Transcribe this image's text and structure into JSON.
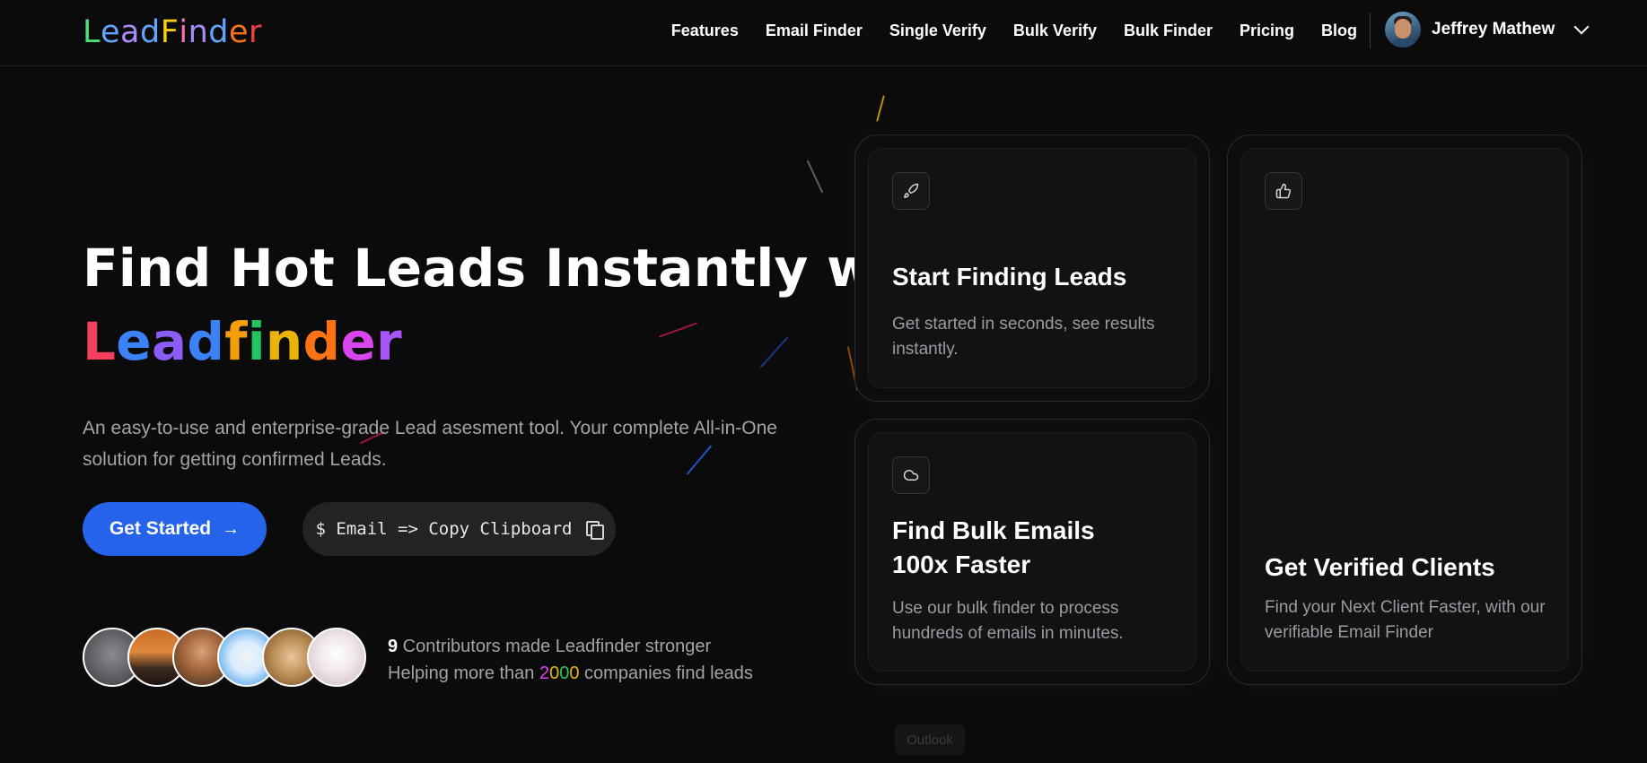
{
  "brand": {
    "logo_letters": [
      {
        "ch": "L",
        "color": "#4ade80"
      },
      {
        "ch": "e",
        "color": "#60a5fa"
      },
      {
        "ch": "a",
        "color": "#a78bfa"
      },
      {
        "ch": "d",
        "color": "#60a5fa"
      },
      {
        "ch": "F",
        "color": "#facc15"
      },
      {
        "ch": "i",
        "color": "#f472b6"
      },
      {
        "ch": "n",
        "color": "#a78bfa"
      },
      {
        "ch": "d",
        "color": "#60a5fa"
      },
      {
        "ch": "e",
        "color": "#f97316"
      },
      {
        "ch": "r",
        "color": "#ef4444"
      }
    ]
  },
  "nav": {
    "links": [
      "Features",
      "Email Finder",
      "Single Verify",
      "Bulk Verify",
      "Bulk Finder",
      "Pricing",
      "Blog"
    ],
    "user_name": "Jeffrey Mathew"
  },
  "hero": {
    "title_line1": "Find Hot Leads Instantly with",
    "title_line2_letters": [
      {
        "ch": "L",
        "color": "#f43f5e"
      },
      {
        "ch": "e",
        "color": "#3b82f6"
      },
      {
        "ch": "a",
        "color": "#8b5cf6"
      },
      {
        "ch": "d",
        "color": "#3b82f6"
      },
      {
        "ch": "f",
        "color": "#f59e0b"
      },
      {
        "ch": "i",
        "color": "#22c55e"
      },
      {
        "ch": "n",
        "color": "#eab308"
      },
      {
        "ch": "d",
        "color": "#f97316"
      },
      {
        "ch": "e",
        "color": "#d946ef"
      },
      {
        "ch": "r",
        "color": "#a855f7"
      }
    ],
    "subtitle": "An easy-to-use and enterprise-grade Lead asesment tool. Your complete All-in-One solution for getting confirmed Leads.",
    "get_started_label": "Get Started",
    "copy_label": "$ Email => Copy Clipboard",
    "contributors_count": "9",
    "contributors_text": " Contributors made Leadfinder stronger",
    "helping_prefix": "Helping more than ",
    "helping_digits": [
      "2",
      "0",
      "0",
      "0"
    ],
    "helping_suffix": " companies find leads"
  },
  "cards": [
    {
      "icon": "rocket-icon",
      "title": "Start Finding Leads",
      "desc": "Get started in seconds, see results instantly."
    },
    {
      "icon": "cloud-icon",
      "title": "Find Bulk Emails 100x Faster",
      "desc": "Use our bulk finder to process hundreds of emails in minutes."
    },
    {
      "icon": "thumbs-up-icon",
      "title": "Get Verified Clients",
      "desc": "Find your Next Client Faster, with our verifiable Email Finder"
    }
  ],
  "footer_hint": "Outlook",
  "colors": {
    "accent": "#2563eb",
    "background": "#0b0b0c"
  }
}
